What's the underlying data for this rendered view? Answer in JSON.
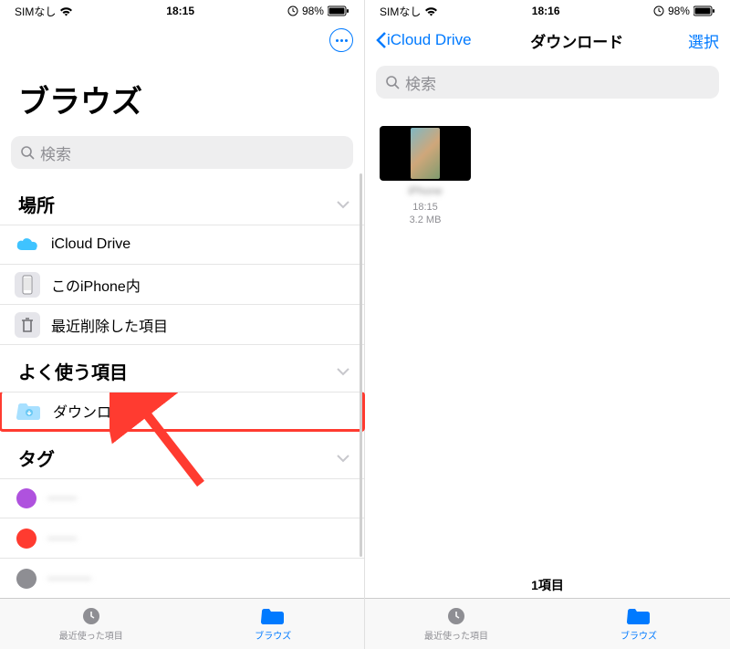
{
  "left": {
    "status": {
      "carrier": "SIMなし",
      "time": "18:15",
      "battery": "98%"
    },
    "title": "ブラウズ",
    "search_placeholder": "検索",
    "sections": {
      "locations": {
        "header": "場所",
        "items": [
          {
            "label": "iCloud Drive"
          },
          {
            "label": "このiPhone内"
          },
          {
            "label": "最近削除した項目"
          }
        ]
      },
      "favorites": {
        "header": "よく使う項目",
        "items": [
          {
            "label": "ダウンロード"
          }
        ]
      },
      "tags": {
        "header": "タグ",
        "items": [
          {
            "color": "#af52de",
            "label": "――"
          },
          {
            "color": "#ff3b30",
            "label": "――"
          },
          {
            "color": "#8e8e93",
            "label": "―――"
          },
          {
            "color": "#34c759",
            "label": "――――"
          }
        ]
      }
    },
    "tabs": {
      "recent": "最近使った項目",
      "browse": "ブラウズ"
    }
  },
  "right": {
    "status": {
      "carrier": "SIMなし",
      "time": "18:16",
      "battery": "98%"
    },
    "nav": {
      "back": "iCloud Drive",
      "title": "ダウンロード",
      "select": "選択"
    },
    "search_placeholder": "検索",
    "files": [
      {
        "name": "iPhone",
        "time": "18:15",
        "size": "3.2 MB"
      }
    ],
    "footer_count": "1項目",
    "tabs": {
      "recent": "最近使った項目",
      "browse": "ブラウズ"
    }
  }
}
